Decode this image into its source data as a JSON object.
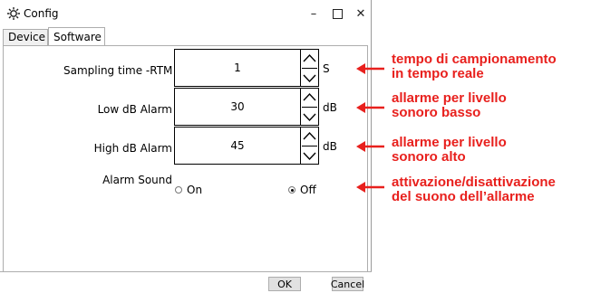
{
  "window": {
    "title": "Config",
    "controls": {
      "minimize": "–",
      "maximize": "",
      "close": "✕"
    }
  },
  "tabs": [
    {
      "label": "Device",
      "active": false
    },
    {
      "label": "Software",
      "active": true
    }
  ],
  "settings": {
    "sampling": {
      "label": "Sampling time -RTM",
      "value": "1",
      "unit": "S"
    },
    "low_alarm": {
      "label": "Low dB Alarm",
      "value": "30",
      "unit": "dB"
    },
    "high_alarm": {
      "label": "High dB Alarm",
      "value": "45",
      "unit": "dB"
    },
    "alarm_sound": {
      "label": "Alarm Sound",
      "options": [
        {
          "label": "On",
          "checked": false
        },
        {
          "label": "Off",
          "checked": true
        }
      ]
    }
  },
  "buttons": {
    "ok": "OK",
    "cancel": "Cancel"
  },
  "annotations": {
    "color": "#e8201d",
    "sampling": [
      "tempo di campionamento",
      "in tempo reale"
    ],
    "low_alarm": [
      "allarme per livello",
      "sonoro basso"
    ],
    "high_alarm": [
      "allarme per livello",
      "sonoro alto"
    ],
    "alarm_sound": [
      "attivazione/disattivazione",
      "del suono dell’allarme"
    ]
  },
  "icons": {
    "app": "gear-icon",
    "spin_up": "chevron-up-icon",
    "spin_down": "chevron-down-icon",
    "arrow": "arrow-left-icon"
  }
}
